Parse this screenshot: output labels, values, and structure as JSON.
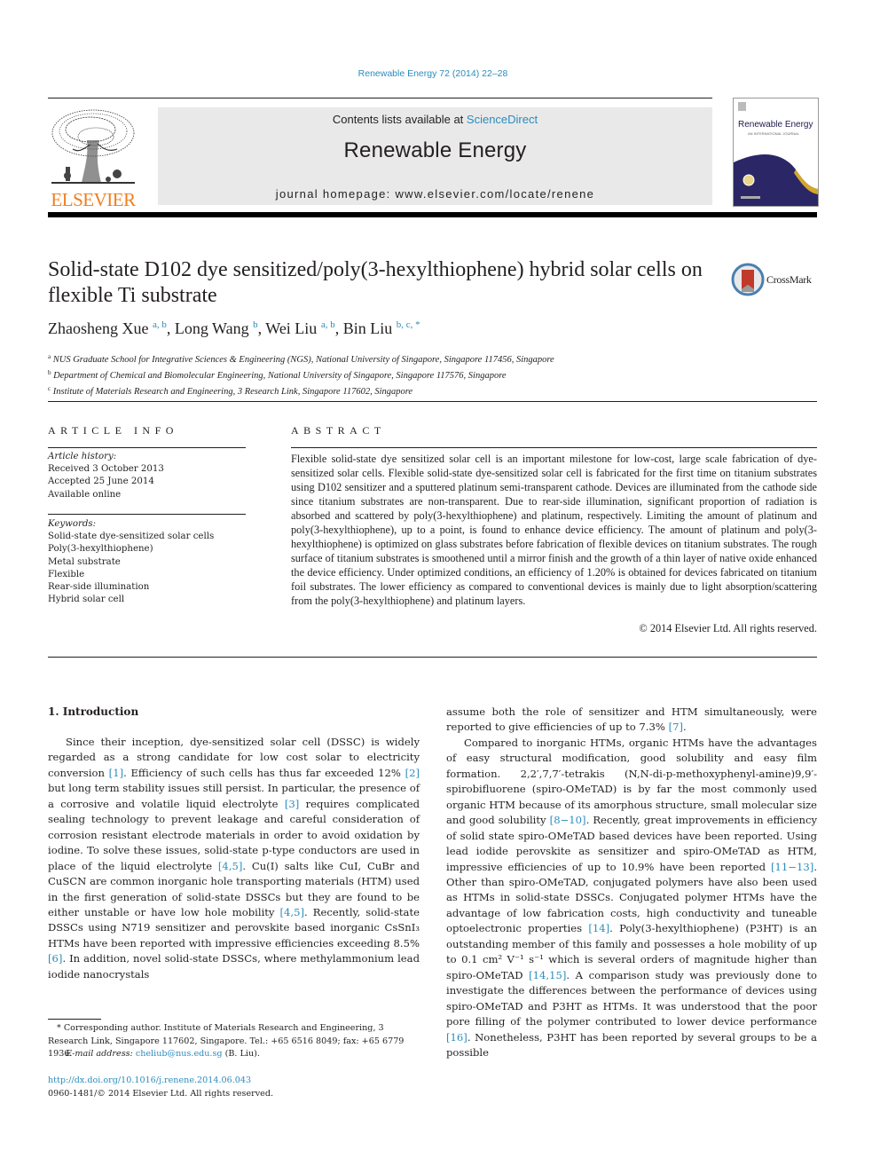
{
  "header": {
    "citation": "Renewable Energy 72 (2014) 22–28",
    "contents_prefix": "Contents lists available at ",
    "contents_link": "ScienceDirect",
    "journal_name": "Renewable Energy",
    "homepage": "journal homepage: www.elsevier.com/locate/renene",
    "publisher_logo": "ELSEVIER",
    "cover": {
      "title": "Renewable Energy",
      "subtitle": "AN INTERNATIONAL JOURNAL",
      "colors": {
        "navy": "#2b2666",
        "gold": "#d4a62a"
      }
    }
  },
  "article": {
    "title": "Solid-state D102 dye sensitized/poly(3-hexylthiophene) hybrid solar cells on flexible Ti substrate",
    "crossmark_label": "CrossMark",
    "authors": [
      {
        "name": "Zhaosheng Xue",
        "affil": "a, b",
        "sep": ", "
      },
      {
        "name": "Long Wang",
        "affil": "b",
        "sep": ", "
      },
      {
        "name": "Wei Liu",
        "affil": "a, b",
        "sep": ", "
      },
      {
        "name": "Bin Liu",
        "affil": "b, c, *",
        "sep": ""
      }
    ],
    "affiliations": [
      {
        "key": "a",
        "text": "NUS Graduate School for Integrative Sciences & Engineering (NGS), National University of Singapore, Singapore 117456, Singapore"
      },
      {
        "key": "b",
        "text": "Department of Chemical and Biomolecular Engineering, National University of Singapore, Singapore 117576, Singapore"
      },
      {
        "key": "c",
        "text": "Institute of Materials Research and Engineering, 3 Research Link, Singapore 117602, Singapore"
      }
    ]
  },
  "article_info": {
    "heading": "ARTICLE INFO",
    "history_label": "Article history:",
    "history": [
      "Received 3 October 2013",
      "Accepted 25 June 2014",
      "Available online"
    ],
    "keywords_label": "Keywords:",
    "keywords": [
      "Solid-state dye-sensitized solar cells",
      "Poly(3-hexylthiophene)",
      "Metal substrate",
      "Flexible",
      "Rear-side illumination",
      "Hybrid solar cell"
    ]
  },
  "abstract": {
    "heading": "ABSTRACT",
    "text": "Flexible solid-state dye sensitized solar cell is an important milestone for low-cost, large scale fabrication of dye-sensitized solar cells. Flexible solid-state dye-sensitized solar cell is fabricated for the first time on titanium substrates using D102 sensitizer and a sputtered platinum semi-transparent cathode. Devices are illuminated from the cathode side since titanium substrates are non-transparent. Due to rear-side illumination, significant proportion of radiation is absorbed and scattered by poly(3-hexylthiophene) and platinum, respectively. Limiting the amount of platinum and poly(3-hexylthiophene), up to a point, is found to enhance device efficiency. The amount of platinum and poly(3-hexylthiophene) is optimized on glass substrates before fabrication of flexible devices on titanium substrates. The rough surface of titanium substrates is smoothened until a mirror finish and the growth of a thin layer of native oxide enhanced the device efficiency. Under optimized conditions, an efficiency of 1.20% is obtained for devices fabricated on titanium foil substrates. The lower efficiency as compared to conventional devices is mainly due to light absorption/scattering from the poly(3-hexylthiophene) and platinum layers.",
    "copyright": "© 2014 Elsevier Ltd. All rights reserved."
  },
  "body": {
    "section_title": "1.  Introduction",
    "left_column": [
      {
        "t": "Since their inception, dye-sensitized solar cell (DSSC) is widely regarded as a strong candidate for low cost solar to electricity conversion "
      },
      {
        "ref": "[1]"
      },
      {
        "t": ". Efficiency of such cells has thus far exceeded 12% "
      },
      {
        "ref": "[2]"
      },
      {
        "t": " but long term stability issues still persist. In particular, the presence of a corrosive and volatile liquid electrolyte "
      },
      {
        "ref": "[3]"
      },
      {
        "t": " requires compli­cated sealing technology to prevent leakage and careful consider­ation of corrosion resistant electrode materials in order to avoid oxidation by iodine. To solve these issues, solid-state p-type con­ductors are used in place of the liquid electrolyte "
      },
      {
        "ref": "[4,5]"
      },
      {
        "t": ". Cu(I) salts like CuI, CuBr and CuSCN are common inorganic hole transporting materials (HTM) used in the first generation of solid-state DSSCs but they are found to be either unstable or have low hole mobility "
      },
      {
        "ref": "[4,5]"
      },
      {
        "t": ". Recently, solid-state DSSCs using N719 sensitizer and perov­skite based inorganic CsSnI₃ HTMs have been reported with impressive efficiencies exceeding 8.5% "
      },
      {
        "ref": "[6]"
      },
      {
        "t": ". In addition, novel solid-state DSSCs, where methylammonium lead iodide nanocrystals"
      }
    ],
    "right_para1": [
      {
        "t": "assume both the role of sensitizer and HTM simultaneously, were reported to give efficiencies of up to 7.3% "
      },
      {
        "ref": "[7]"
      },
      {
        "t": "."
      }
    ],
    "right_para2": [
      {
        "t": "Compared to inorganic HTMs, organic HTMs have the advan­tages of easy structural modification, good solubility and easy film formation. 2,2′,7,7′-tetrakis (N,N-di-p-methoxyphenyl-amine)9,9′-spirobifluorene (spiro-OMeTAD) is by far the most commonly used organic HTM because of its amorphous structure, small molecular size and good solubility "
      },
      {
        "ref": "[8−10]"
      },
      {
        "t": ". Recently, great improvements in efficiency of solid state spiro-OMeTAD based devices have been reported. Using lead iodide perovskite as sensitizer and spiro-OMeTAD as HTM, impressive efficiencies of up to 10.9% have been reported "
      },
      {
        "ref": "[11−13]"
      },
      {
        "t": ". Other than spiro-OMeTAD, conjugated polymers have also been used as HTMs in solid-state DSSCs. Conjugated polymer HTMs have the advantage of low fabrication costs, high conductivity and tuneable optoelectronic properties "
      },
      {
        "ref": "[14]"
      },
      {
        "t": ". Poly(3-hexylthiophene) (P3HT) is an outstanding member of this family and possesses a hole mobility of up to 0.1 cm² V⁻¹ s⁻¹ which is several orders of magnitude higher than spiro-OMeTAD "
      },
      {
        "ref": "[14,15]"
      },
      {
        "t": ". A comparison study was previously done to investigate the differ­ences between the performance of devices using spiro-OMeTAD and P3HT as HTMs. It was understood that the poor pore filling of the polymer contributed to lower device performance "
      },
      {
        "ref": "[16]"
      },
      {
        "t": ". None­theless, P3HT has been reported by several groups to be a possible"
      }
    ]
  },
  "footnotes": {
    "corresponding": "* Corresponding author. Institute of Materials Research and Engineering, 3 Research Link, Singapore 117602, Singapore. Tel.: +65 6516 8049; fax: +65 6779 1936.",
    "email_label": "E-mail address: ",
    "email": "cheliub@nus.edu.sg",
    "email_suffix": " (B. Liu).",
    "doi": "http://dx.doi.org/10.1016/j.renene.2014.06.043",
    "issn": "0960-1481/© 2014 Elsevier Ltd. All rights reserved."
  },
  "colors": {
    "link": "#2a8cbd",
    "elsevier_orange": "#f07e1c",
    "masthead_bg": "#e9e9e9"
  }
}
